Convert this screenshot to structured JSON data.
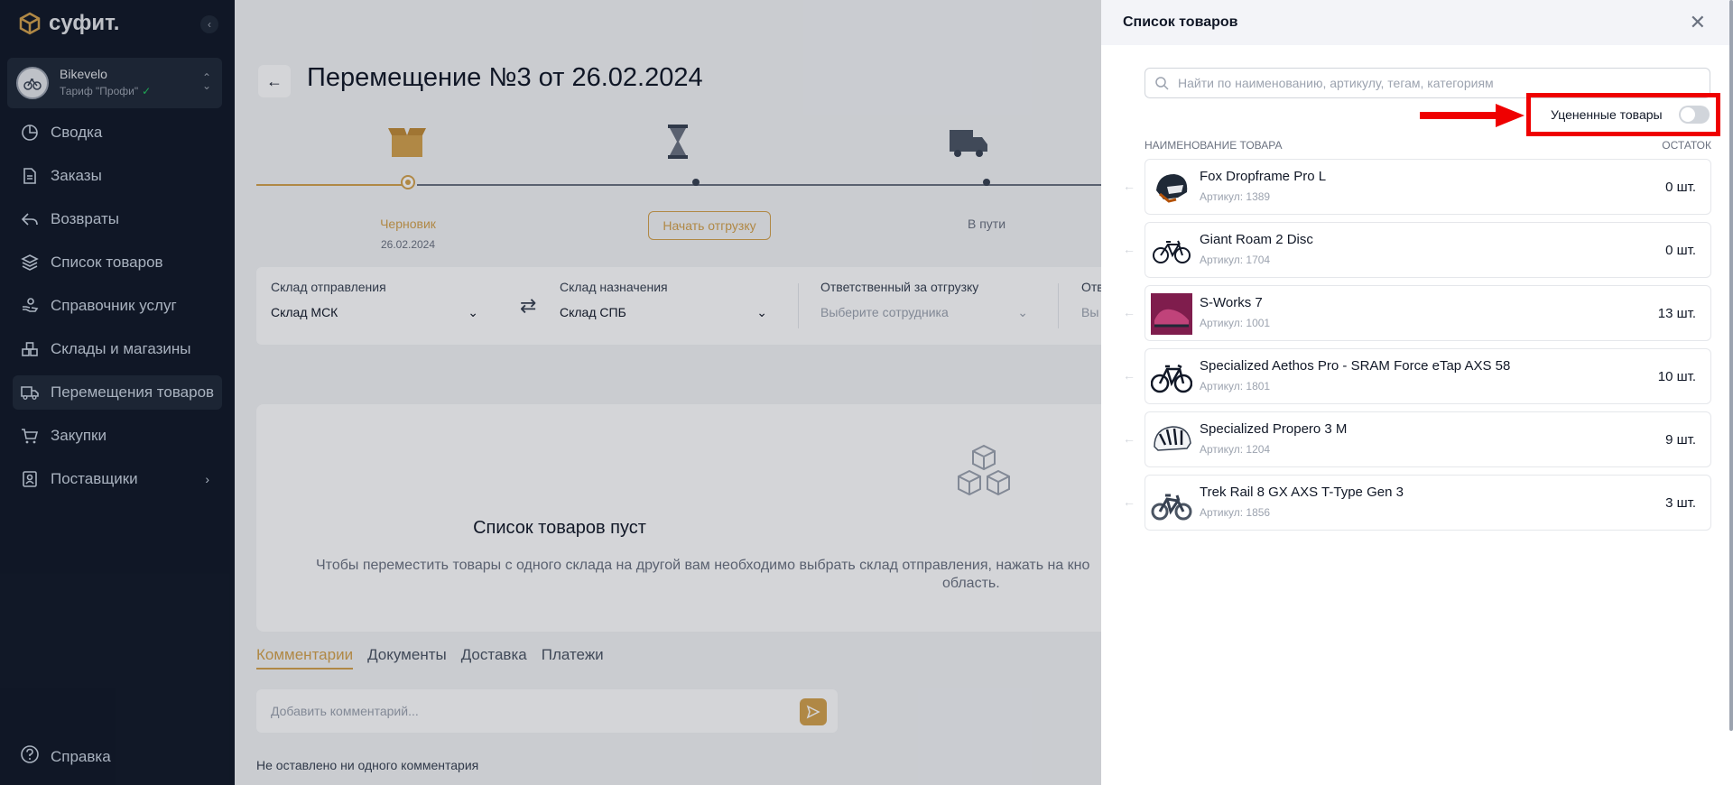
{
  "sidebar": {
    "brand": "суфит.",
    "org_name": "Bikevelo",
    "org_plan": "Тариф \"Профи\"",
    "items": [
      {
        "label": "Сводка",
        "icon": "pie-chart-icon"
      },
      {
        "label": "Заказы",
        "icon": "document-icon"
      },
      {
        "label": "Возвраты",
        "icon": "reply-icon"
      },
      {
        "label": "Список товаров",
        "icon": "layers-icon"
      },
      {
        "label": "Справочник услуг",
        "icon": "hand-service-icon"
      },
      {
        "label": "Склады и магазины",
        "icon": "boxes-icon"
      },
      {
        "label": "Перемещения товаров",
        "icon": "truck-icon"
      },
      {
        "label": "Закупки",
        "icon": "cart-icon"
      },
      {
        "label": "Поставщики",
        "icon": "contact-icon"
      }
    ],
    "help": "Справка"
  },
  "main": {
    "title": "Перемещение №3 от 26.02.2024",
    "steps": {
      "draft": "Черновик",
      "draft_date": "26.02.2024",
      "ship_button": "Начать отгрузку",
      "in_transit": "В пути"
    },
    "fields": {
      "from_label": "Склад отправления",
      "from_value": "Склад МСК",
      "to_label": "Склад назначения",
      "to_value": "Склад СПБ",
      "resp_label": "Ответственный за отгрузку",
      "resp_placeholder": "Выберите сотрудника",
      "extra_label": "Отв",
      "extra_value": "Вы"
    },
    "empty": {
      "title": "Список товаров пуст",
      "text": "Чтобы переместить товары с одного склада на другой вам необходимо выбрать склад отправления, нажать на кно",
      "text2": "область."
    },
    "tabs": [
      "Комментарии",
      "Документы",
      "Доставка",
      "Платежи"
    ],
    "comment_placeholder": "Добавить комментарий...",
    "no_comments": "Не оставлено ни одного комментария"
  },
  "drawer": {
    "title": "Список товаров",
    "search_placeholder": "Найти по наименованию, артикулу, тегам, категориям",
    "discount_label": "Уцененные товары",
    "discount_on": false,
    "col_name": "НАИМЕНОВАНИЕ ТОВАРА",
    "col_stock": "ОСТАТОК",
    "products": [
      {
        "name": "Fox Dropframe Pro L",
        "sku": "Артикул: 1389",
        "qty": "0 шт.",
        "img": "helmet"
      },
      {
        "name": "Giant Roam 2 Disc",
        "sku": "Артикул: 1704",
        "qty": "0 шт.",
        "img": "bike"
      },
      {
        "name": "S-Works 7",
        "sku": "Артикул: 1001",
        "qty": "13 шт.",
        "img": "shoe"
      },
      {
        "name": "Specialized Aethos Pro - SRAM Force eTap AXS 58",
        "sku": "Артикул: 1801",
        "qty": "10 шт.",
        "img": "road-bike"
      },
      {
        "name": "Specialized Propero 3 M",
        "sku": "Артикул: 1204",
        "qty": "9 шт.",
        "img": "helmet-white"
      },
      {
        "name": "Trek Rail 8 GX AXS T-Type Gen 3",
        "sku": "Артикул: 1856",
        "qty": "3 шт.",
        "img": "mtb"
      }
    ]
  },
  "colors": {
    "accent": "#d4a24c",
    "sidebar_bg": "#111827",
    "highlight": "#ef0000"
  }
}
